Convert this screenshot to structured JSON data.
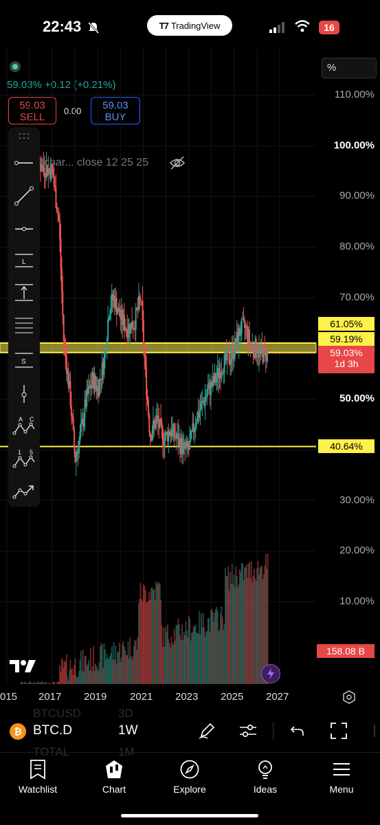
{
  "status": {
    "time": "22:43",
    "app_pill": "TradingView",
    "battery": "16"
  },
  "header": {
    "change": "59.03%  +0.12 (+0.21%)",
    "sell_price": "59.03",
    "sell_label": "SELL",
    "spread": "0.00",
    "buy_price": "59.03",
    "buy_label": "BUY",
    "scale_mode": "%"
  },
  "legend": {
    "text": "char... close 12 25 25"
  },
  "price_scale": {
    "labels": [
      "110.00%",
      "100.00%",
      "90.00%",
      "80.00%",
      "70.00%",
      "50.00%",
      "30.00%",
      "20.00%",
      "10.00%"
    ],
    "tags": {
      "upper": "61.05%",
      "lower": "59.19%",
      "last": "59.03%",
      "countdown": "1d 3h",
      "support": "40.64%",
      "volume": "158.08 B"
    }
  },
  "time_axis": [
    "015",
    "2017",
    "2019",
    "2021",
    "2023",
    "2025",
    "2027"
  ],
  "toolbar_icons": [
    "drag-handle-icon",
    "horizontal-line-icon",
    "trend-line-icon",
    "horizontal-ray-icon",
    "long-position-icon",
    "anchored-text-icon",
    "parallel-channel-icon",
    "short-position-icon",
    "vertical-marker-icon",
    "abc-pattern-icon",
    "elliott-wave-icon",
    "path-icon"
  ],
  "symbol_bar": {
    "symbol": "BTC.D",
    "interval": "1W",
    "ghost_1": "BTCUSD",
    "ghost_2": "3D",
    "ghost_3": "TOTAL",
    "ghost_4": "1M"
  },
  "nav": {
    "watchlist": "Watchlist",
    "chart": "Chart",
    "explore": "Explore",
    "ideas": "Ideas",
    "menu": "Menu"
  },
  "colors": {
    "zone": "#fff04a",
    "up": "#26a69a",
    "down": "#ef5350",
    "accent": "#2962ff"
  },
  "chart_data": {
    "type": "line",
    "symbol": "BTC.D",
    "x": [
      2016.0,
      2016.5,
      2017.0,
      2017.3,
      2017.5,
      2017.8,
      2018.0,
      2018.2,
      2018.5,
      2018.8,
      2019.0,
      2019.3,
      2019.5,
      2019.7,
      2020.0,
      2020.3,
      2020.6,
      2020.9,
      2021.0,
      2021.1,
      2021.3,
      2021.6,
      2021.9,
      2022.2,
      2022.5,
      2022.8,
      2023.0,
      2023.3,
      2023.6,
      2023.9,
      2024.2,
      2024.5,
      2024.8,
      2025.0,
      2025.3,
      2025.5,
      2025.7,
      2025.9,
      2026.2,
      2026.5
    ],
    "values": [
      98,
      96,
      95,
      85,
      62,
      50,
      38,
      42,
      50,
      54,
      52,
      58,
      68,
      70,
      66,
      64,
      65,
      70,
      62,
      55,
      43,
      46,
      42,
      44,
      42,
      40,
      40,
      46,
      49,
      52,
      54,
      57,
      58,
      60,
      64,
      64,
      61,
      60,
      59,
      59.03
    ],
    "ylim": [
      0,
      112
    ],
    "xlim": [
      2015,
      2027
    ],
    "horizontal_levels": [
      61.05,
      59.19,
      40.64
    ],
    "zone": [
      59.19,
      61.05
    ],
    "volume": {
      "last": "158.08 B"
    }
  }
}
